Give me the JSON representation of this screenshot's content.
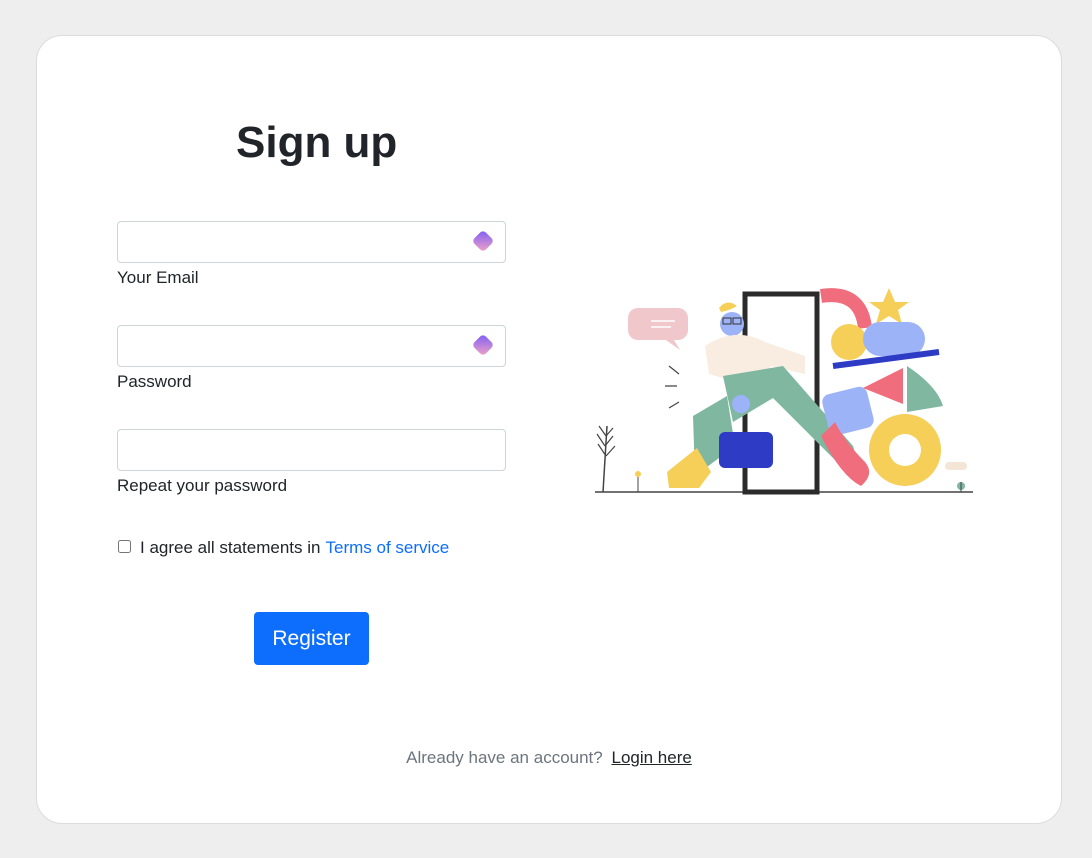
{
  "form": {
    "title": "Sign up",
    "email_label": "Your Email",
    "email_value": "",
    "password_label": "Password",
    "password_value": "",
    "repeat_label": "Repeat your password",
    "repeat_value": "",
    "agree_text": "I agree all statements in",
    "terms_link": "Terms of service",
    "agree_checked": false,
    "register_label": "Register"
  },
  "footer": {
    "prompt": "Already have an account?",
    "login_link": "Login here"
  },
  "icons": {
    "field_extension": "gem-icon",
    "illustration": "person-carrying-shapes-illustration"
  },
  "colors": {
    "primary": "#0d6efd",
    "background": "#eeeeee",
    "card": "#ffffff"
  }
}
